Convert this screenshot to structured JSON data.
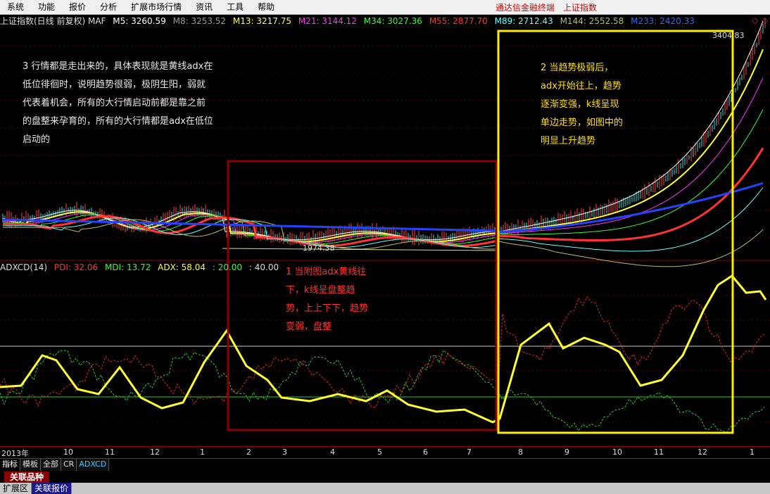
{
  "menu": {
    "items": [
      "系统",
      "功能",
      "报价",
      "分析",
      "扩展市场行情",
      "资讯",
      "工具",
      "帮助"
    ],
    "right_items": [
      "通达信金融终端",
      "上证指数"
    ]
  },
  "title_bar": {
    "name": "上证指数(日线 前复权) MAF",
    "ma": [
      {
        "label": "M5: 3260.59",
        "color": "#ffffff"
      },
      {
        "label": "M8: 3253.52",
        "color": "#9a9a9a"
      },
      {
        "label": "M13: 3217.75",
        "color": "#ffff33"
      },
      {
        "label": "M21: 3144.12",
        "color": "#ff33ff"
      },
      {
        "label": "M34: 3027.36",
        "color": "#33ff33"
      },
      {
        "label": "M55: 2877.70",
        "color": "#ff3333"
      },
      {
        "label": "M89: 2712.43",
        "color": "#66ffff"
      },
      {
        "label": "M144: 2552.58",
        "color": "#bbbb66"
      },
      {
        "label": "M233: 2420.33",
        "color": "#3366ff"
      }
    ],
    "controls": [
      "◇",
      "◇"
    ]
  },
  "price_labels": {
    "high": "3404.83",
    "low": "1974.38"
  },
  "indicator_bar": {
    "name": "ADXCD(14)",
    "pdi": "PDI: 32.06",
    "mdi": "MDI: 13.72",
    "adx": "ADX: 58.04",
    "l1": ": 20.00",
    "l2": ": 40.00"
  },
  "notes": {
    "note1": "1 当附图adx黄线往\n下，k线呈盘整趋\n势，上上下下，趋势\n变弱，盘整",
    "note2": "2 当趋势极弱后，\nadx开始往上，趋势\n逐渐变强，k线呈现\n单边走势，如图中的\n明显上升趋势",
    "note3": "3 行情都是走出来的，具体表现就是黄线adx在\n低位徘徊时，说明趋势很弱，极阴生阳，弱就\n代表着机会，所有的大行情启动前都是靠之前\n的盘整来孕育的，所有的大行情都是adx在低位\n启动的"
  },
  "x_axis": {
    "labels": [
      "2013年",
      "10",
      "11",
      "12",
      "1",
      "2",
      "3",
      "4",
      "5",
      "6",
      "7",
      "8",
      "9",
      "10",
      "11",
      "12",
      "1"
    ]
  },
  "tabs": [
    "指标",
    "模板",
    "全部",
    "CR",
    "ADXCD"
  ],
  "related_label": "关联品种",
  "bottom_tabs": [
    "扩展区",
    "关联报价"
  ],
  "colors": {
    "red_box": "#8b0000",
    "yellow_box": "#ffee00",
    "note_white": "#e8e8e8",
    "note_red": "#ff3333",
    "note_yellow": "#ffe000"
  }
}
